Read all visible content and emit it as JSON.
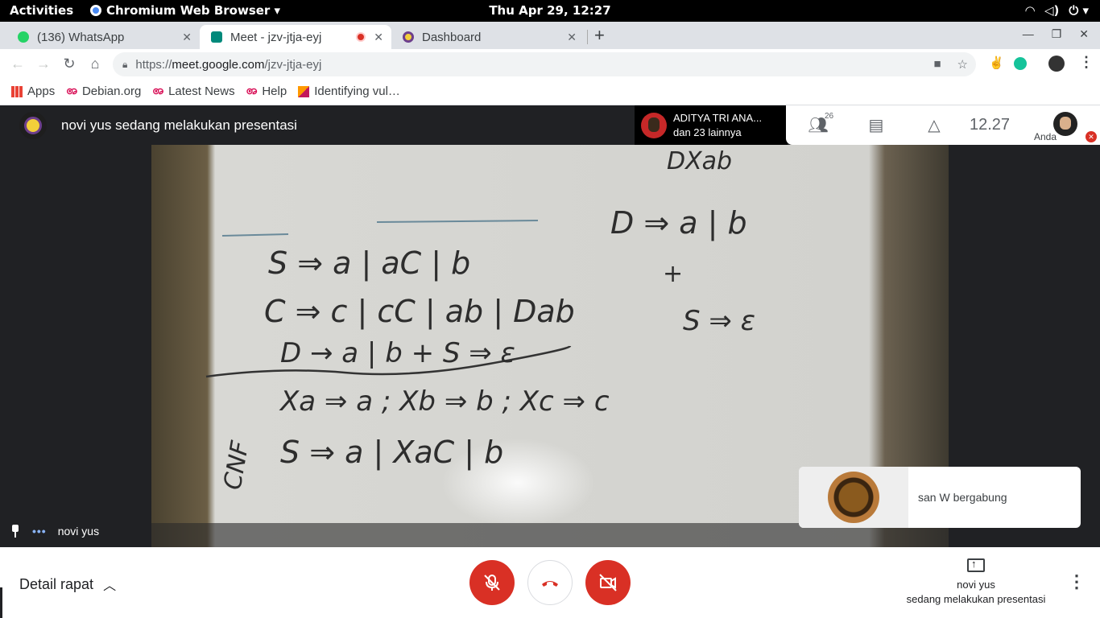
{
  "system_bar": {
    "activities": "Activities",
    "app_name": "Chromium Web Browser ▾",
    "clock": "Thu Apr 29, 12:27"
  },
  "tabs": [
    {
      "label": "(136) WhatsApp",
      "favicon_color": "#25d366"
    },
    {
      "label": "Meet - jzv-jtja-eyj",
      "favicon_color": "#00897b",
      "recording": true
    },
    {
      "label": "Dashboard",
      "favicon_color": "#f3cf3a"
    }
  ],
  "address_bar": {
    "scheme": "https://",
    "host": "meet.google.com",
    "path": "/jzv-jtja-eyj"
  },
  "bookmarks": [
    {
      "label": "Apps",
      "icon": "apps-grid-icon"
    },
    {
      "label": "Debian.org",
      "icon": "debian-icon"
    },
    {
      "label": "Latest News",
      "icon": "debian-icon"
    },
    {
      "label": "Help",
      "icon": "debian-icon"
    },
    {
      "label": "Identifying vul…",
      "icon": "bookmark-icon"
    }
  ],
  "meet": {
    "presenter_title": "novi yus sedang melakukan presentasi",
    "participant_name": "ADITYA TRI ANA...",
    "participant_others": "dan 23 lainnya",
    "people_count": "26",
    "time": "12.27",
    "self_label": "Anda",
    "pinned_name": "novi yus",
    "toast_text": "san W bergabung",
    "meeting_details": "Detail rapat",
    "presenting_name": "novi yus",
    "presenting_text": "sedang melakukan presentasi"
  },
  "whiteboard_lines": [
    "S ⇒ a | aC | b",
    "C ⇒ c | cC | ab | Dab",
    "D → a | b   + S ⇒ ε",
    "Xa ⇒ a ; Xb ⇒ b ; Xc ⇒ c",
    "S ⇒ a | XaC | b",
    "D ⇒ a | b",
    "S ⇒ ε",
    "DXab",
    "CNF",
    "+"
  ],
  "colors": {
    "accent_red": "#d93025",
    "meet_bg": "#202124"
  }
}
